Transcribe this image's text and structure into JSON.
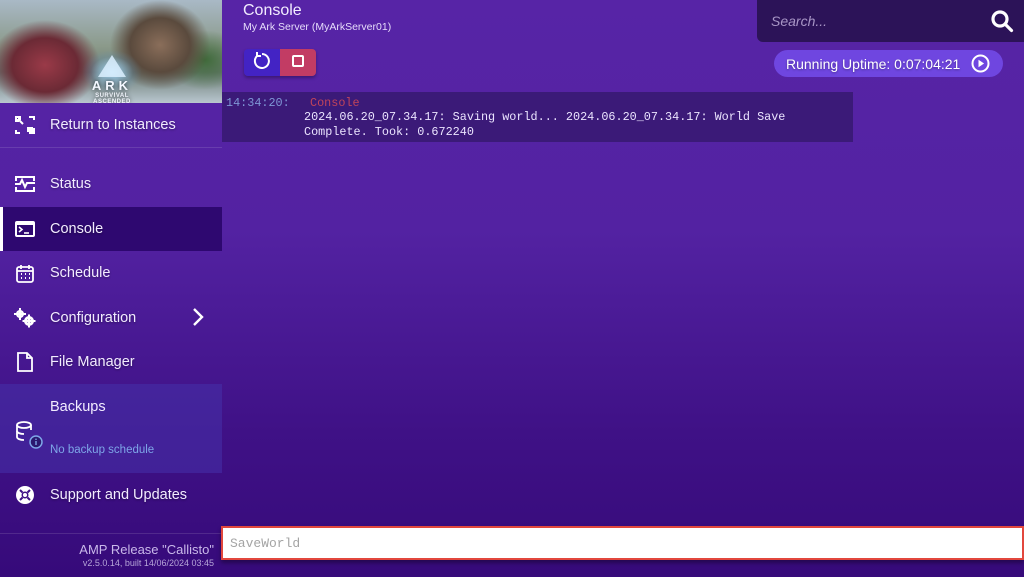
{
  "sidebar": {
    "banner": {
      "title": "ARK",
      "subtitle": "SURVIVAL ASCENDED"
    },
    "return_label": "Return to Instances",
    "items": [
      {
        "label": "Status",
        "icon": "status-icon"
      },
      {
        "label": "Console",
        "icon": "terminal-icon",
        "active": true
      },
      {
        "label": "Schedule",
        "icon": "calendar-icon"
      },
      {
        "label": "Configuration",
        "icon": "gears-icon",
        "has_submenu": true
      },
      {
        "label": "File Manager",
        "icon": "file-icon"
      }
    ],
    "backups": {
      "label": "Backups",
      "status": "No backup schedule",
      "icon": "database-info-icon"
    },
    "support_label": "Support and Updates",
    "release": {
      "name": "AMP Release \"Callisto\"",
      "build": "v2.5.0.14, built 14/06/2024 03:45"
    }
  },
  "header": {
    "title": "Console",
    "subtitle": "My Ark Server (MyArkServer01)",
    "controls": {
      "restart": "restart-icon",
      "stop": "stop-icon"
    },
    "search": {
      "placeholder": "Search...",
      "value": ""
    },
    "uptime": {
      "label": "Running Uptime: 0:07:04:21",
      "icon": "play-circle-icon"
    }
  },
  "console": {
    "entries": [
      {
        "time": "14:34:20:",
        "source": "Console",
        "message": "2024.06.20_07.34.17: Saving world... 2024.06.20_07.34.17: World Save Complete. Took: 0.672240"
      }
    ],
    "input": {
      "placeholder": "SaveWorld",
      "value": ""
    }
  },
  "colors": {
    "background_top": "#5724a6",
    "background_bottom": "#360a7a",
    "active_item": "#2e0870",
    "restart_button": "#4323c4",
    "stop_button": "#c23c64",
    "uptime_pill": "#6f46e0",
    "search_bg": "#2c1358",
    "console_source": "#c0445a",
    "console_time": "#7f97d6",
    "input_border": "#e2473d"
  }
}
